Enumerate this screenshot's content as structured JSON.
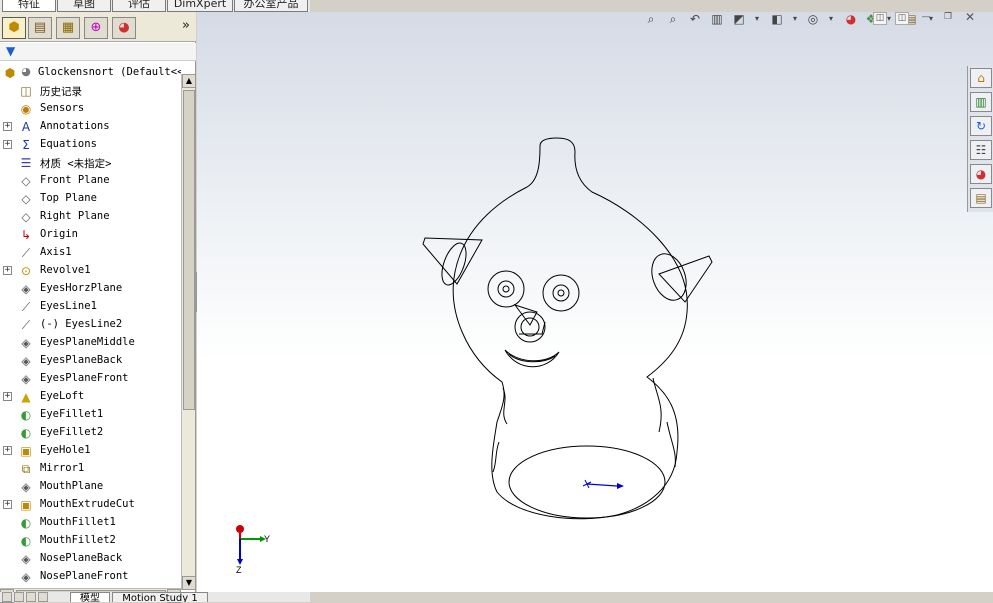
{
  "top_tabs": [
    "特征",
    "草图",
    "评估",
    "DimXpert",
    "办公室产品"
  ],
  "bottom_tabs": [
    "模型",
    "Motion Study 1"
  ],
  "tree": {
    "root": {
      "label": "Glockensnort  (Default<<"
    },
    "items": [
      {
        "label": "历史记录",
        "icon": "history-icon",
        "glyph": "◫",
        "expandable": false
      },
      {
        "label": "Sensors",
        "icon": "sensors-icon",
        "glyph": "◉",
        "expandable": false
      },
      {
        "label": "Annotations",
        "icon": "annotations-icon",
        "glyph": "A",
        "expandable": true
      },
      {
        "label": "Equations",
        "icon": "equations-icon",
        "glyph": "Σ",
        "expandable": true
      },
      {
        "label": "材质 <未指定>",
        "icon": "material-icon",
        "glyph": "☰",
        "expandable": false
      },
      {
        "label": "Front Plane",
        "icon": "plane-icon",
        "glyph": "◇",
        "expandable": false
      },
      {
        "label": "Top Plane",
        "icon": "plane-icon",
        "glyph": "◇",
        "expandable": false
      },
      {
        "label": "Right Plane",
        "icon": "plane-icon",
        "glyph": "◇",
        "expandable": false
      },
      {
        "label": "Origin",
        "icon": "origin-icon",
        "glyph": "↳",
        "expandable": false
      },
      {
        "label": "Axis1",
        "icon": "axis-icon",
        "glyph": "⟋",
        "expandable": false
      },
      {
        "label": "Revolve1",
        "icon": "revolve-icon",
        "glyph": "⊙",
        "expandable": true
      },
      {
        "label": "EyesHorzPlane",
        "icon": "plane-icon",
        "glyph": "◈",
        "expandable": false
      },
      {
        "label": "EyesLine1",
        "icon": "sketch-icon",
        "glyph": "⟋",
        "expandable": false
      },
      {
        "label": "(-) EyesLine2",
        "icon": "sketch-icon",
        "glyph": "⟋",
        "expandable": false
      },
      {
        "label": "EyesPlaneMiddle",
        "icon": "plane-icon",
        "glyph": "◈",
        "expandable": false
      },
      {
        "label": "EyesPlaneBack",
        "icon": "plane-icon",
        "glyph": "◈",
        "expandable": false
      },
      {
        "label": "EyesPlaneFront",
        "icon": "plane-icon",
        "glyph": "◈",
        "expandable": false
      },
      {
        "label": "EyeLoft",
        "icon": "loft-icon",
        "glyph": "▲",
        "expandable": true
      },
      {
        "label": "EyeFillet1",
        "icon": "fillet-icon",
        "glyph": "◐",
        "expandable": false
      },
      {
        "label": "EyeFillet2",
        "icon": "fillet-icon",
        "glyph": "◐",
        "expandable": false
      },
      {
        "label": "EyeHole1",
        "icon": "hole-icon",
        "glyph": "▣",
        "expandable": true
      },
      {
        "label": "Mirror1",
        "icon": "mirror-icon",
        "glyph": "⧉",
        "expandable": false
      },
      {
        "label": "MouthPlane",
        "icon": "plane-icon",
        "glyph": "◈",
        "expandable": false
      },
      {
        "label": "MouthExtrudeCut",
        "icon": "cut-icon",
        "glyph": "▣",
        "expandable": true
      },
      {
        "label": "MouthFillet1",
        "icon": "fillet-icon",
        "glyph": "◐",
        "expandable": false
      },
      {
        "label": "MouthFillet2",
        "icon": "fillet-icon",
        "glyph": "◐",
        "expandable": false
      },
      {
        "label": "NosePlaneBack",
        "icon": "plane-icon",
        "glyph": "◈",
        "expandable": false
      },
      {
        "label": "NosePlaneFront",
        "icon": "plane-icon",
        "glyph": "◈",
        "expandable": false
      }
    ]
  },
  "triad": {
    "x_label": "Y",
    "y_label": "Z"
  }
}
